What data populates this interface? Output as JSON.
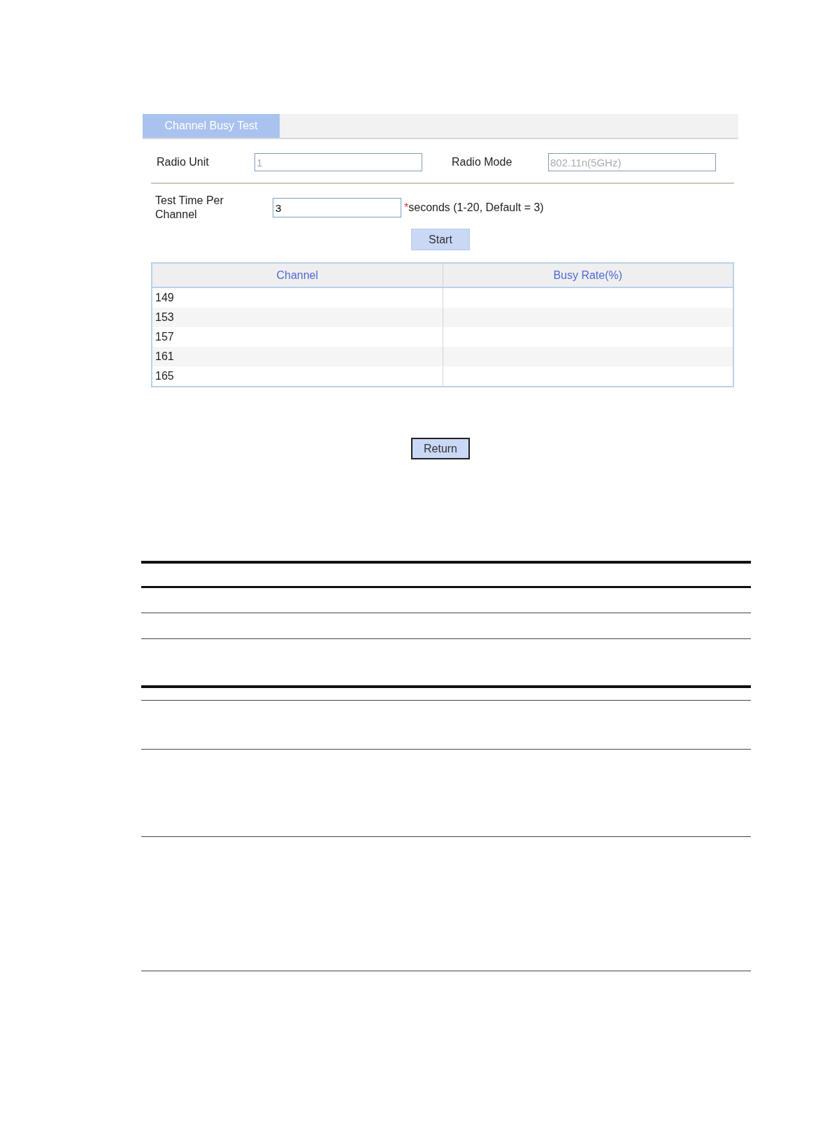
{
  "tabs": [
    {
      "label": "Channel Busy Test",
      "selected": true
    }
  ],
  "radio_fields": [
    {
      "label": "Radio Unit",
      "value": "1",
      "disabled": true
    },
    {
      "label": "Radio Mode",
      "value": "802.11n(5GHz)",
      "disabled": true
    }
  ],
  "test_time": {
    "label": "Test Time Per Channel",
    "value": "3",
    "required_mark": "*",
    "hint": "seconds (1-20, Default = 3)"
  },
  "start_button": "Start",
  "table": {
    "columns": [
      "Channel",
      "Busy Rate(%)"
    ],
    "rows": [
      [
        "149",
        ""
      ],
      [
        "153",
        ""
      ],
      [
        "157",
        ""
      ],
      [
        "161",
        ""
      ],
      [
        "165",
        ""
      ]
    ]
  },
  "return_button": "Return"
}
